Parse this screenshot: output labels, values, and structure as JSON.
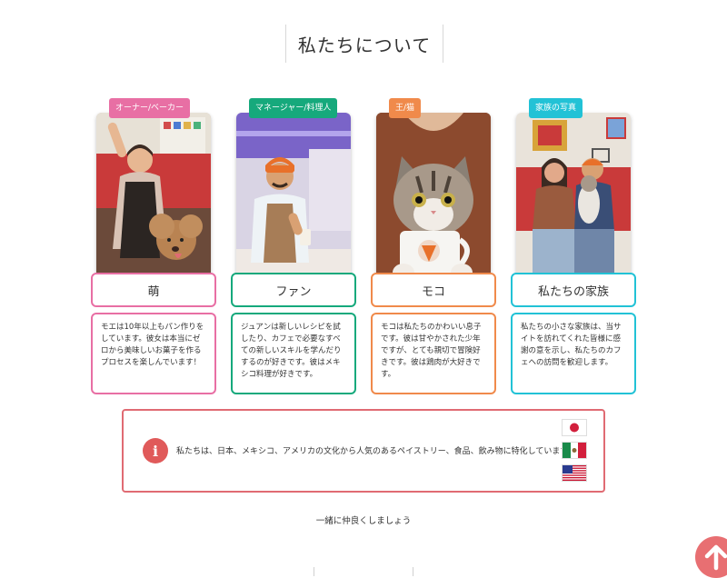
{
  "section": {
    "title": "私たちについて"
  },
  "members": [
    {
      "tag": "オーナー/ベーカー",
      "name": "萌",
      "description": "モエは10年以上もパン作りをしています。彼女は本当にゼロから美味しいお菓子を作るプロセスを楽しんでいます！",
      "accent": "#e86fa4",
      "photo": "owner-baker-photo"
    },
    {
      "tag": "マネージャー/料理人",
      "name": "ファン",
      "description": "ジュアンは新しいレシピを試したり、カフェで必要なすべての新しいスキルを学んだりするのが好きです。彼はメキシコ料理が好きです。",
      "accent": "#16a97c",
      "photo": "manager-chef-photo"
    },
    {
      "tag": "王/猫",
      "name": "モコ",
      "description": "モコは私たちのかわいい息子です。彼は甘やかされた少年ですが、とても親切で冒険好きです。彼は鶏肉が大好きです。",
      "accent": "#f08a4b",
      "photo": "cat-photo"
    },
    {
      "tag": "家族の写真",
      "name": "私たちの家族",
      "description": "私たちの小さな家族は、当サイトを訪れてくれた皆様に感謝の意を示し、私たちのカフェへの訪問を歓迎します。",
      "accent": "#22c2d6",
      "photo": "family-photo"
    }
  ],
  "info": {
    "icon": "info-icon",
    "text": "私たちは、日本、メキシコ、アメリカの文化から人気のあるペイストリー、食品、飲み物に特化しています！",
    "flags": [
      "japan-flag",
      "mexico-flag",
      "usa-flag"
    ],
    "border_color": "#e06b73"
  },
  "footer": {
    "text": "一緒に仲良くしましょう"
  },
  "scroll_top": {
    "icon": "arrow-up-icon",
    "color": "#e86f72"
  }
}
